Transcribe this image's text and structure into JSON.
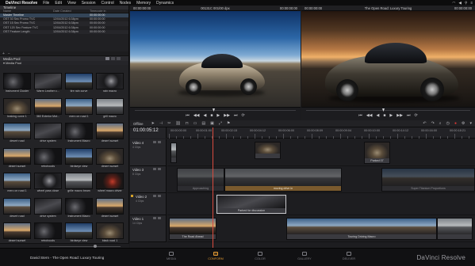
{
  "menubar": {
    "app_name": "DaVinci Resolve",
    "menus": [
      "File",
      "Edit",
      "View",
      "Session",
      "Control",
      "Nodes",
      "Memory",
      "Dynamics"
    ]
  },
  "timelines_panel": {
    "title": "Timeline",
    "columns": [
      "Name",
      "Date Created",
      "Timecode in"
    ],
    "rows": [
      {
        "name": "Master Timeline",
        "date": "",
        "tc": "00:00:00:00"
      },
      {
        "name": "OST 30 Sec Promo TVC",
        "date": "12/04/2012 6:38pm",
        "tc": "00:00:00:00"
      },
      {
        "name": "OST 15 Sec Promo TVC",
        "date": "12/04/2012 6:38pm",
        "tc": "00:00:00:00"
      },
      {
        "name": "OST 120 Sec Feature TVC",
        "date": "12/04/2012 6:38pm",
        "tc": "00:00:00:00"
      },
      {
        "name": "OST Feature Length",
        "date": "12/04/2012 6:38pm",
        "tc": "00:00:00:00"
      }
    ]
  },
  "media_pool": {
    "title": "Media Pool",
    "bin": "Media Pool",
    "clips": [
      {
        "label": "Instrument Cluster",
        "thumb": "t-dash"
      },
      {
        "label": "Warm Leather c...",
        "thumb": "t-dark"
      },
      {
        "label": "tire rain curve",
        "thumb": "t-sky"
      },
      {
        "label": "rain macro",
        "thumb": "t-wheel"
      },
      {
        "label": "braking curve 1",
        "thumb": "t-car"
      },
      {
        "label": "360 Exterior Mot...",
        "thumb": "t-sunset"
      },
      {
        "label": "merc on road 1",
        "thumb": "t-road"
      },
      {
        "label": "grill macro",
        "thumb": "t-grey"
      },
      {
        "label": "desert road",
        "thumb": "t-road"
      },
      {
        "label": "drive system",
        "thumb": "t-dark"
      },
      {
        "label": "Instrument Macro",
        "thumb": "t-dash"
      },
      {
        "label": "desert sunset",
        "thumb": "t-sunset"
      },
      {
        "label": "desert sunset",
        "thumb": "t-sunset"
      },
      {
        "label": "retrohoods",
        "thumb": "t-dash"
      },
      {
        "label": "birdseye view",
        "thumb": "t-sky"
      },
      {
        "label": "desert sunset",
        "thumb": "t-car"
      },
      {
        "label": "merc on road 1",
        "thumb": "t-road"
      },
      {
        "label": "wheel pass close",
        "thumb": "t-wheel"
      },
      {
        "label": "grille macro beam",
        "thumb": "t-grey"
      },
      {
        "label": "wheel macro driver",
        "thumb": "t-red"
      },
      {
        "label": "desert road",
        "thumb": "t-road"
      },
      {
        "label": "drive system",
        "thumb": "t-dark"
      },
      {
        "label": "Instrument Macro",
        "thumb": "t-dash"
      },
      {
        "label": "desert sunset",
        "thumb": "t-sunset"
      },
      {
        "label": "desert sunset",
        "thumb": "t-sunset"
      },
      {
        "label": "retrohoods",
        "thumb": "t-dash"
      },
      {
        "label": "birdseye view",
        "thumb": "t-sky"
      },
      {
        "label": "black road 1",
        "thumb": "t-car"
      }
    ]
  },
  "source_viewer": {
    "tc_left": "00:00:00:00",
    "clip": "00131C 001/00 dpx",
    "tc_right": "00:00:00:00"
  },
  "record_viewer": {
    "tc_left": "00:00:00:00",
    "clip": "The Open Road: Luxury Touring",
    "tc_right": "00:00:00:00"
  },
  "transport": {
    "icons": [
      "⏮",
      "◀◀",
      "◀",
      "■",
      "▶",
      "▶▶",
      "⏭",
      "⟳"
    ]
  },
  "toolbar": {
    "mode": "Offline"
  },
  "timeline": {
    "timecode": "01:00:05:12",
    "ruler_labels": [
      "00:00:00:00",
      "00:00:01:00",
      "00:00:02:15",
      "00:00:04:12",
      "00:00:06:00",
      "00:00:08:09",
      "00:00:09:04",
      "00:00:10:00",
      "00:00:14:12",
      "00:00:16:00",
      "00:00:18:21"
    ],
    "tracks": [
      {
        "name": "Video 4",
        "sub": "4 Clips"
      },
      {
        "name": "Video 3",
        "sub": "8 Clips"
      },
      {
        "name": "Video 2",
        "sub": "4 Clips"
      },
      {
        "name": "Video 1",
        "sub": "14 Clips"
      }
    ],
    "clips": {
      "v4_a": "",
      "v4_b": "Parked 07",
      "v3_a": "Approaching",
      "v3_b": "moving drive in",
      "v3_c": "Super Titanium Proportions",
      "v2_a": "Parked for discussion",
      "v1_a": "The Road Ahead",
      "v1_b": "Touring Driving Macro"
    }
  },
  "pages": {
    "project": "David Stern - The Open Road: Luxury Touring",
    "tabs": [
      "MEDIA",
      "CONFORM",
      "COLOR",
      "GALLERY",
      "DELIVER"
    ],
    "active": "CONFORM",
    "brand": "DaVinci Resolve"
  }
}
